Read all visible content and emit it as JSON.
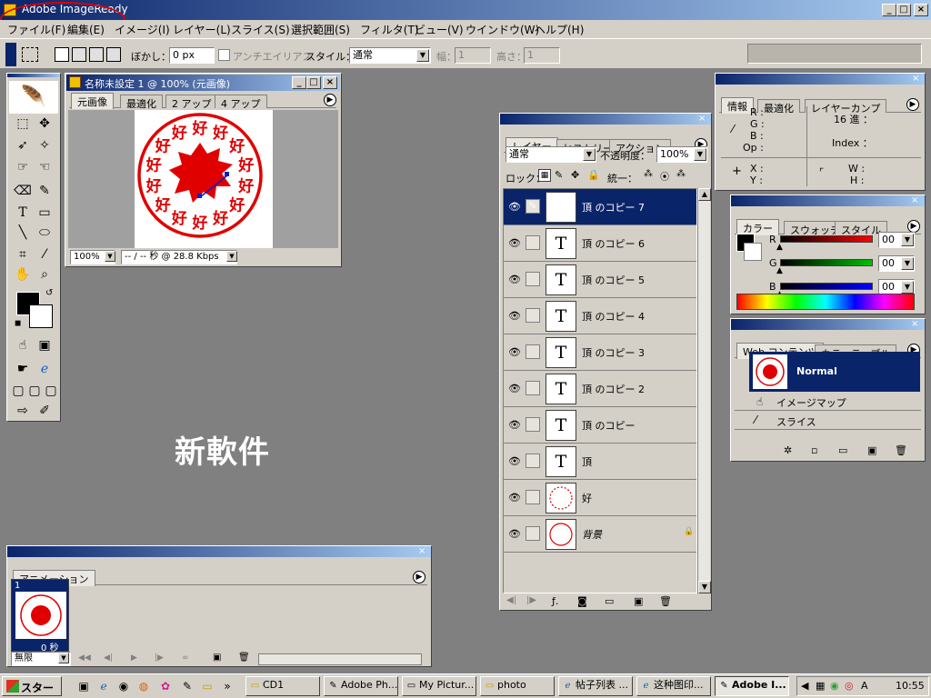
{
  "app": {
    "title": "Adobe ImageReady",
    "menu": [
      "ファイル(F)",
      "編集(E)",
      "イメージ(I)",
      "レイヤー(L)",
      "スライス(S)",
      "選択範囲(S)",
      "フィルタ(T)",
      "ビュー(V)",
      "ウインドウ(W)",
      "ヘルプ(H)"
    ],
    "win_buttons": [
      "_",
      "□",
      "×"
    ]
  },
  "options": {
    "feather_label": "ぼかし：",
    "feather_value": "0 px",
    "antialias_label": "アンチエイリアス",
    "style_label": "スタイル：",
    "style_value": "通常",
    "width_label": "幅：",
    "width_value": "1",
    "height_label": "高さ：",
    "height_value": "1"
  },
  "doc": {
    "title": "名称未設定 1 @ 100% (元画像)",
    "tabs": [
      "元画像",
      "最適化",
      "2 アップ",
      "4 アップ"
    ],
    "zoom": "100%",
    "status": "-- / -- 秒 @ 28.8 Kbps",
    "ring_char": "好"
  },
  "info": {
    "tabs": [
      "情報",
      "最適化",
      "レイヤーカンプ"
    ],
    "rgb_labels": [
      "R :",
      "G :",
      "B :",
      "Op :"
    ],
    "hex_label": "16 進 ：",
    "index_label": "Index ：",
    "xy_labels": [
      "X :",
      "Y :"
    ],
    "wh_labels": [
      "W :",
      "H :"
    ]
  },
  "color": {
    "tabs": [
      "カラー",
      "スウォッチ",
      "スタイル"
    ],
    "channels": [
      {
        "label": "R",
        "value": "00",
        "color": "#ff0000"
      },
      {
        "label": "G",
        "value": "00",
        "color": "#00c000"
      },
      {
        "label": "B",
        "value": "00",
        "color": "#0000ff"
      }
    ]
  },
  "web": {
    "tabs": [
      "Web コンテンツ",
      "カラーテーブル"
    ],
    "items": [
      "Normal",
      "イメージマップ",
      "スライス"
    ]
  },
  "layers": {
    "tabs": [
      "レイヤー",
      "ヒストリー",
      "アクション"
    ],
    "blend": "通常",
    "opacity_label": "不透明度：",
    "opacity": "100%",
    "lock_label": "ロック：",
    "unify_label": "統一：",
    "rows": [
      {
        "name": "頂 のコピー 7",
        "thumb": "T",
        "selected": true
      },
      {
        "name": "頂 のコピー 6",
        "thumb": "T"
      },
      {
        "name": "頂 のコピー 5",
        "thumb": "T"
      },
      {
        "name": "頂 のコピー 4",
        "thumb": "T"
      },
      {
        "name": "頂 のコピー 3",
        "thumb": "T"
      },
      {
        "name": "頂 のコピー 2",
        "thumb": "T"
      },
      {
        "name": "頂 のコピー",
        "thumb": "T"
      },
      {
        "name": "頂",
        "thumb": "T"
      },
      {
        "name": "好",
        "thumb": ""
      },
      {
        "name": "背景",
        "thumb": ""
      }
    ]
  },
  "animation": {
    "tab": "アニメーション",
    "frame_number": "1",
    "frame_delay": "0 秒",
    "loop": "無限"
  },
  "watermark": "新軟件",
  "taskbar": {
    "start": "スタート",
    "buttons": [
      "CD1",
      "Adobe Ph...",
      "My Pictur...",
      "photo",
      "帖子列表 ...",
      "这种图印...",
      "Adobe I..."
    ],
    "clock": "10:55"
  },
  "colors": {
    "title_dark": "#0a246a",
    "title_light": "#a6caf0",
    "face": "#d4d0c8",
    "workspace": "#808080",
    "stamp_red": "#e00000",
    "annotation_red": "#e00000"
  }
}
